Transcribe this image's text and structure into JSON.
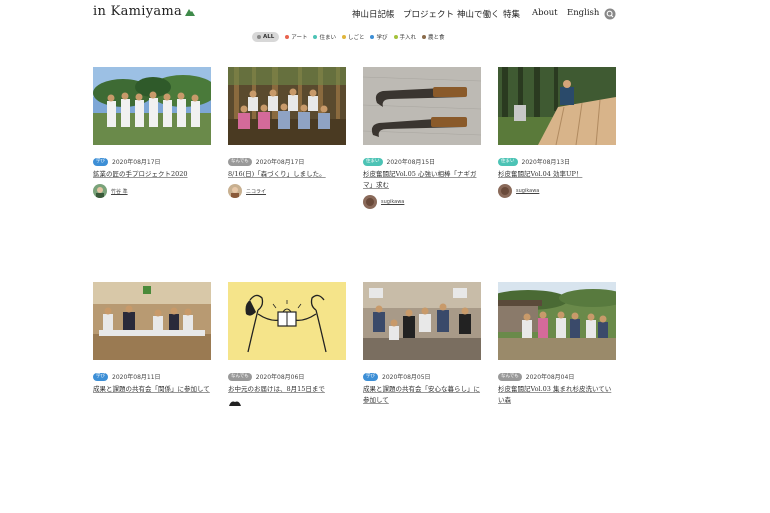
{
  "site": {
    "logo": "in Kamiyama"
  },
  "nav": [
    "神山日記帳",
    "プロジェクト",
    "神山で働く",
    "特集",
    "About",
    "English"
  ],
  "filters": [
    {
      "label": "ALL",
      "color": "#aaaaaa"
    },
    {
      "label": "アート",
      "color": "#e8634e"
    },
    {
      "label": "住まい",
      "color": "#4cc3b5"
    },
    {
      "label": "しごと",
      "color": "#e0b53a"
    },
    {
      "label": "学び",
      "color": "#3d8fd6"
    },
    {
      "label": "手入れ",
      "color": "#a4c23a"
    },
    {
      "label": "農と食",
      "color": "#8a6b4a"
    }
  ],
  "cards": [
    {
      "badge": "学び",
      "badge_color": "#3d8fd6",
      "date": "2020年08月17日",
      "title": "鉱業の匠の手プロジェクト2020",
      "author": "竹谷 準"
    },
    {
      "badge": "なんでも",
      "badge_color": "#999999",
      "date": "2020年08月17日",
      "title": "8/16(日)「森づくり」しました。",
      "author": "ニコライ"
    },
    {
      "badge": "住まい",
      "badge_color": "#4cc3b5",
      "date": "2020年08月15日",
      "title": "杉皮奮闘記Vol.05 心強い相棒「ナギガマ」求む",
      "author": "sugikawa"
    },
    {
      "badge": "住まい",
      "badge_color": "#4cc3b5",
      "date": "2020年08月13日",
      "title": "杉皮奮闘記Vol.04 効率UP！",
      "author": "sugikawa"
    },
    {
      "badge": "学び",
      "badge_color": "#3d8fd6",
      "date": "2020年08月11日",
      "title": "成果と課題の共有会「関係」に参加して",
      "author": ""
    },
    {
      "badge": "なんでも",
      "badge_color": "#999999",
      "date": "2020年08月06日",
      "title": "お中元のお届けは、8月15日まで",
      "author": ""
    },
    {
      "badge": "学び",
      "badge_color": "#3d8fd6",
      "date": "2020年08月05日",
      "title": "成果と課題の共有会「安心な暮らし」に参加して",
      "author": ""
    },
    {
      "badge": "なんでも",
      "badge_color": "#999999",
      "date": "2020年08月04日",
      "title": "杉皮奮闘記Vol.03 集まれ杉皮洗いていい森",
      "author": ""
    }
  ]
}
